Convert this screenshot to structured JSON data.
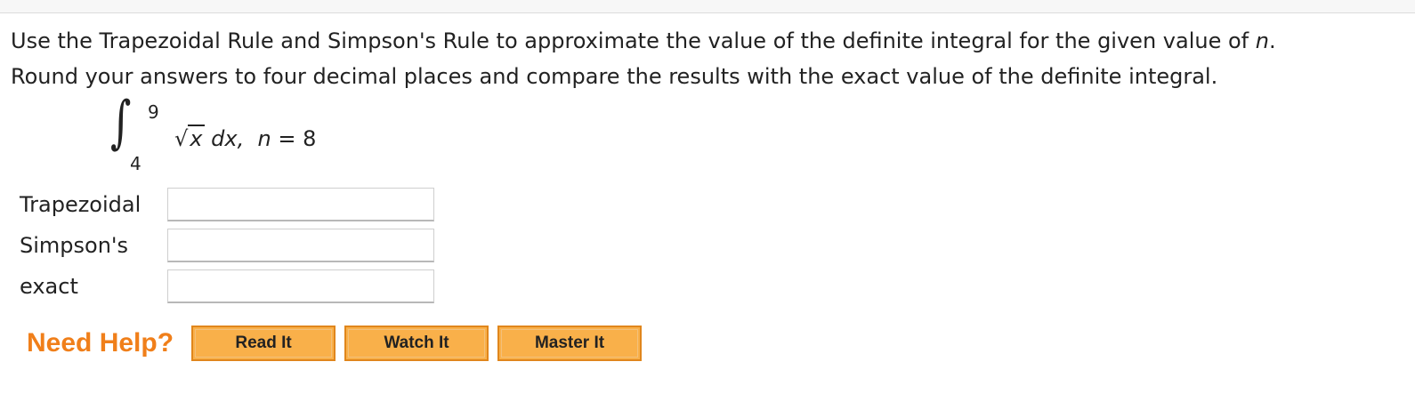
{
  "question": {
    "line1_before": "Use the Trapezoidal Rule and Simpson's Rule to approximate the value of the definite integral for the given value of ",
    "line1_var": "n",
    "line1_after": ".",
    "line2": "Round your answers to four decimal places and compare the results with the exact value of the definite integral."
  },
  "integral": {
    "upper": "9",
    "lower": "4",
    "radicand": "x",
    "differential": "dx,",
    "n_var": "n",
    "n_eq": " = 8"
  },
  "answers": [
    {
      "label": "Trapezoidal",
      "value": ""
    },
    {
      "label": "Simpson's",
      "value": ""
    },
    {
      "label": "exact",
      "value": ""
    }
  ],
  "help": {
    "label": "Need Help?",
    "buttons": [
      "Read It",
      "Watch It",
      "Master It"
    ]
  }
}
